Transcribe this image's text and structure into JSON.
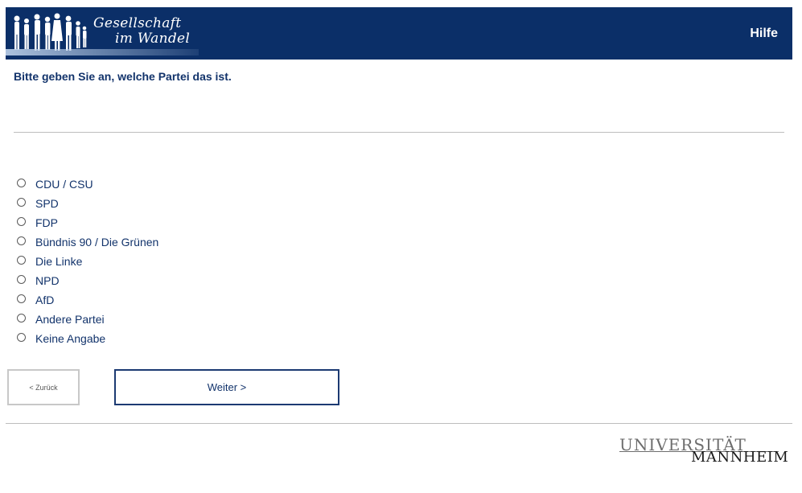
{
  "header": {
    "logo_line1": "Gesellschaft",
    "logo_line2": "im Wandel",
    "help_label": "Hilfe",
    "background_color": "#0b2f68"
  },
  "question": {
    "text": "Bitte geben Sie an, welche Partei das ist."
  },
  "options": [
    {
      "label": "CDU / CSU",
      "selected": false
    },
    {
      "label": "SPD",
      "selected": false
    },
    {
      "label": "FDP",
      "selected": false
    },
    {
      "label": "Bündnis 90 / Die Grünen",
      "selected": false
    },
    {
      "label": "Die Linke",
      "selected": false
    },
    {
      "label": "NPD",
      "selected": false
    },
    {
      "label": "AfD",
      "selected": false
    },
    {
      "label": "Andere Partei",
      "selected": false
    },
    {
      "label": "Keine Angabe",
      "selected": false
    }
  ],
  "navigation": {
    "back_label": "< Zurück",
    "next_label": "Weiter >"
  },
  "footer": {
    "logo_line1": "UNIVERSITÄT",
    "logo_line2": "MANNHEIM"
  }
}
